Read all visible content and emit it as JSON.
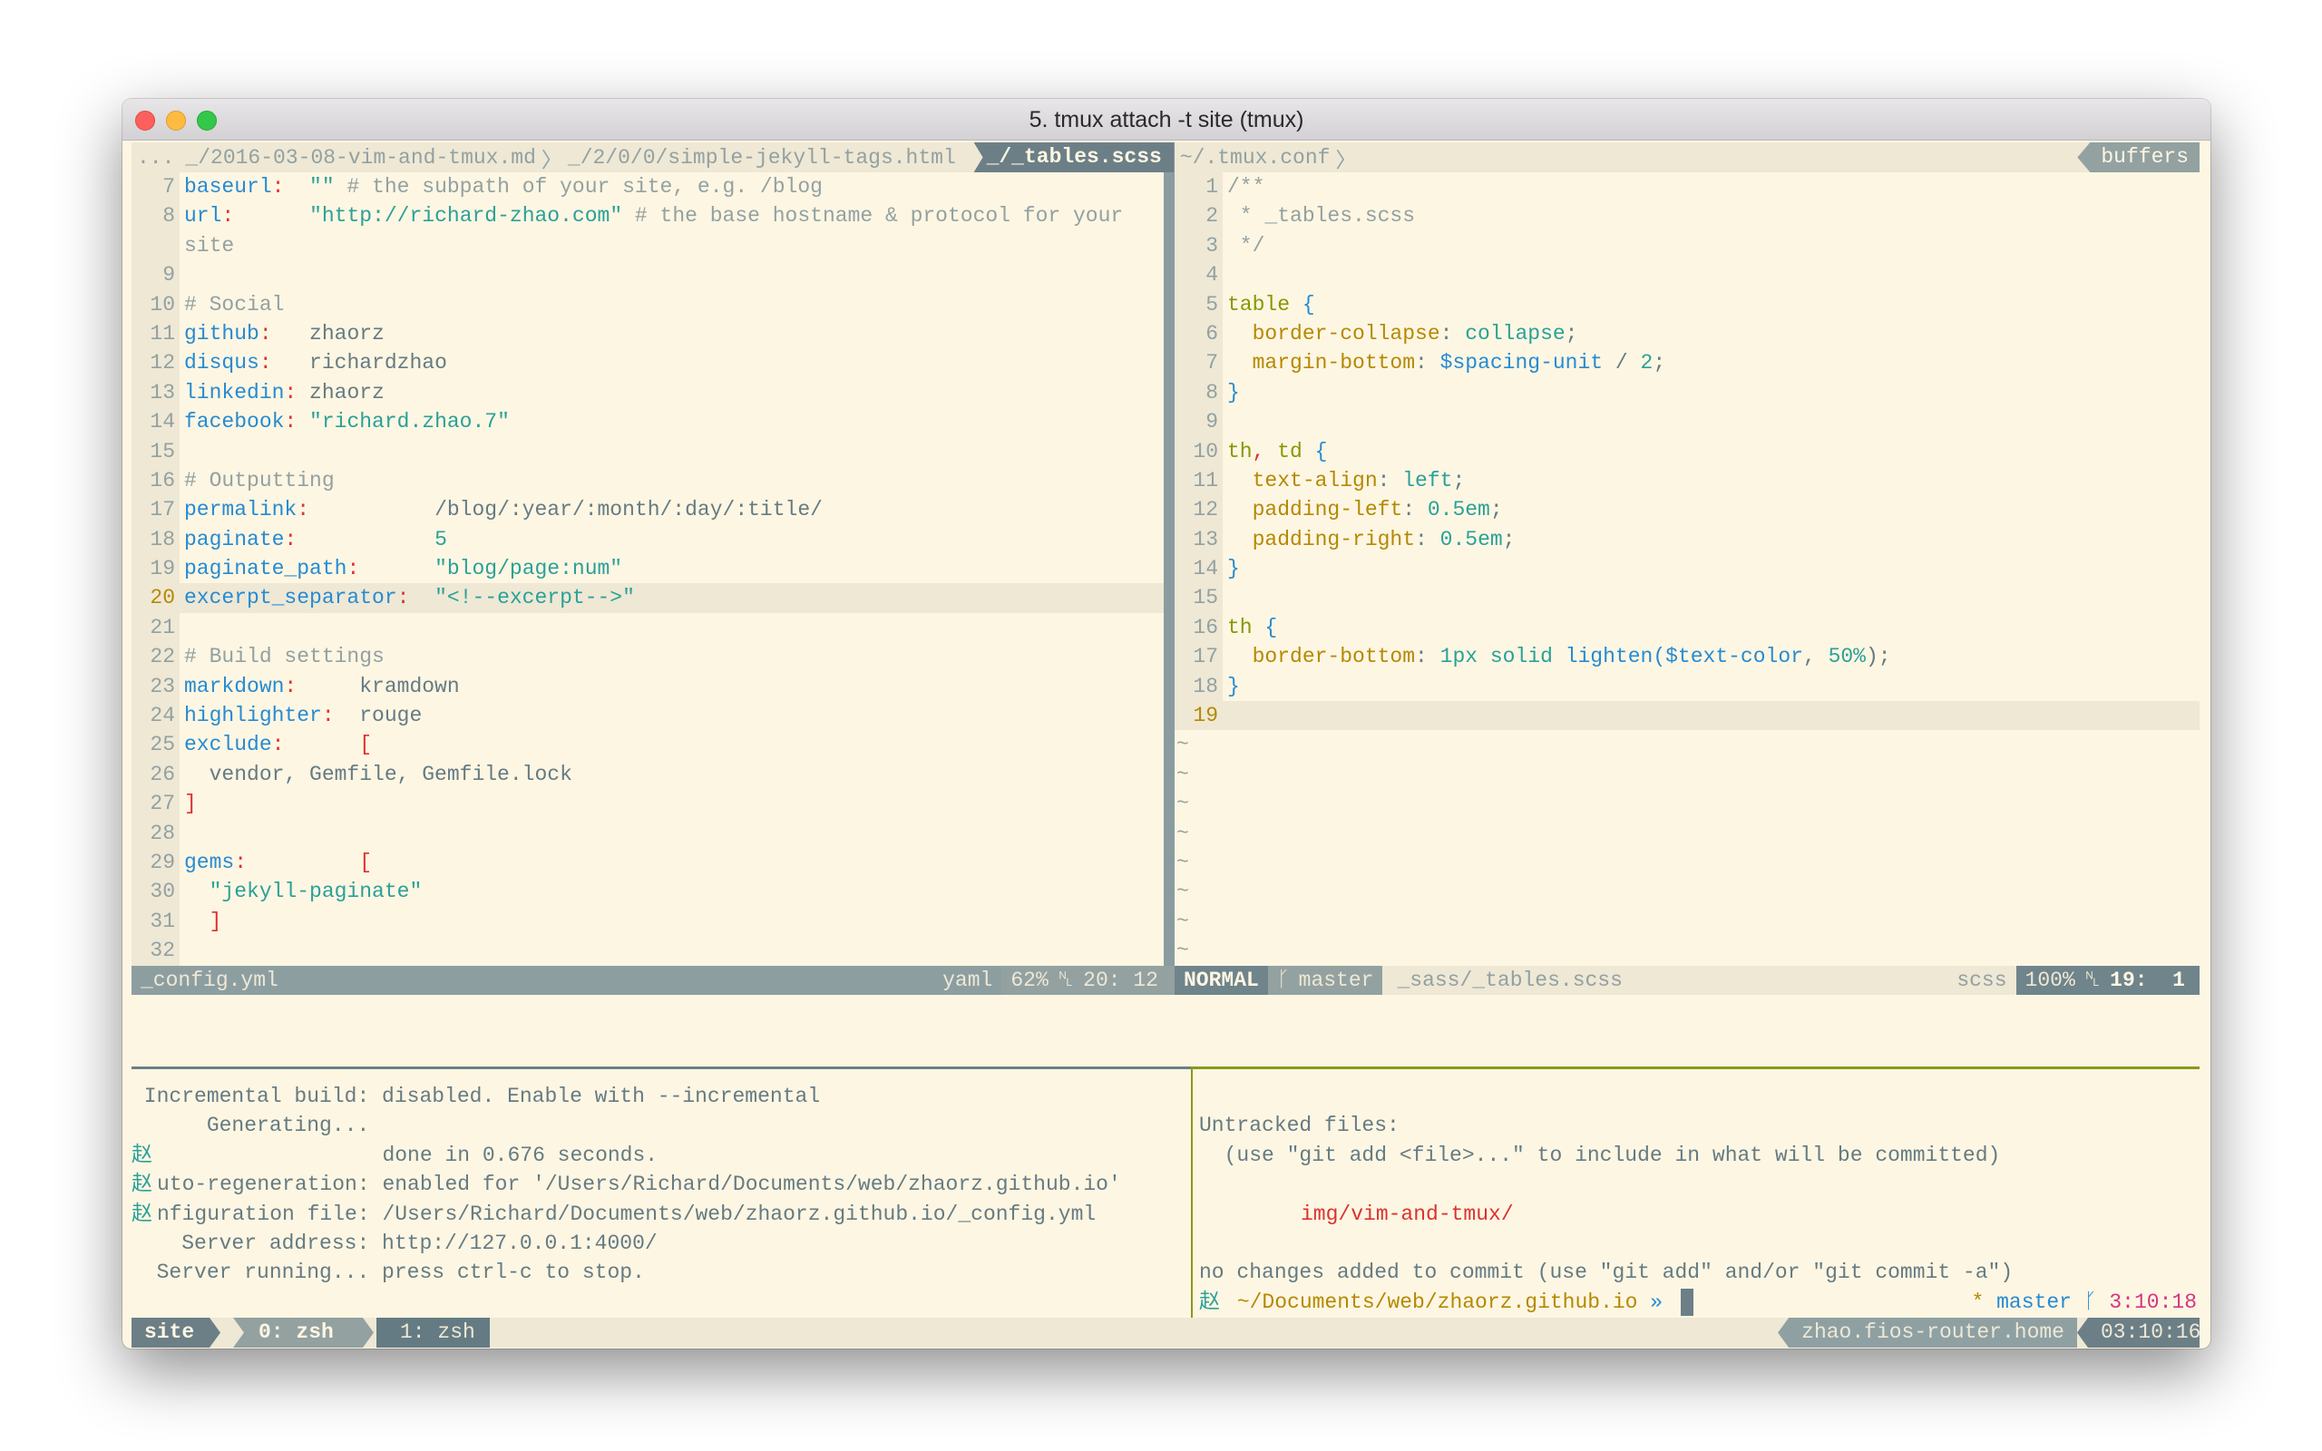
{
  "window": {
    "title": "5. tmux attach -t site (tmux)"
  },
  "tabline": {
    "ellipsis": "...",
    "tabs": [
      {
        "label": "_/2016-03-08-vim-and-tmux.md",
        "active": false
      },
      {
        "label": "_/2/0/0/simple-jekyll-tags.html",
        "active": false
      },
      {
        "label": "_/_tables.scss",
        "active": true
      },
      {
        "label": "~/.tmux.conf",
        "active": false
      }
    ],
    "buffers_label": "buffers"
  },
  "left_pane": {
    "lines": [
      {
        "n": "7",
        "tokens": [
          [
            "k",
            "baseurl"
          ],
          [
            "p",
            ":"
          ],
          [
            "t",
            "  "
          ],
          [
            "s",
            "\"\""
          ],
          [
            "c",
            " # the subpath of your site, e.g. /blog"
          ]
        ]
      },
      {
        "n": "8",
        "tokens": [
          [
            "k",
            "url"
          ],
          [
            "p",
            ":"
          ],
          [
            "t",
            "      "
          ],
          [
            "s",
            "\"http://richard-zhao.com\""
          ],
          [
            "c",
            " # the base hostname & protocol for your"
          ]
        ]
      },
      {
        "n": "",
        "tokens": [
          [
            "c",
            "site"
          ]
        ]
      },
      {
        "n": "9",
        "tokens": []
      },
      {
        "n": "10",
        "tokens": [
          [
            "c",
            "# Social"
          ]
        ]
      },
      {
        "n": "11",
        "tokens": [
          [
            "k",
            "github"
          ],
          [
            "p",
            ":"
          ],
          [
            "t",
            "   zhaorz"
          ]
        ]
      },
      {
        "n": "12",
        "tokens": [
          [
            "k",
            "disqus"
          ],
          [
            "p",
            ":"
          ],
          [
            "t",
            "   richardzhao"
          ]
        ]
      },
      {
        "n": "13",
        "tokens": [
          [
            "k",
            "linkedin"
          ],
          [
            "p",
            ":"
          ],
          [
            "t",
            " zhaorz"
          ]
        ]
      },
      {
        "n": "14",
        "tokens": [
          [
            "k",
            "facebook"
          ],
          [
            "p",
            ":"
          ],
          [
            "t",
            " "
          ],
          [
            "s",
            "\"richard.zhao.7\""
          ]
        ]
      },
      {
        "n": "15",
        "tokens": []
      },
      {
        "n": "16",
        "tokens": [
          [
            "c",
            "# Outputting"
          ]
        ]
      },
      {
        "n": "17",
        "tokens": [
          [
            "k",
            "permalink"
          ],
          [
            "p",
            ":"
          ],
          [
            "t",
            "          /blog/:year/:month/:day/:title/"
          ]
        ]
      },
      {
        "n": "18",
        "tokens": [
          [
            "k",
            "paginate"
          ],
          [
            "p",
            ":"
          ],
          [
            "t",
            "           "
          ],
          [
            "s",
            "5"
          ]
        ]
      },
      {
        "n": "19",
        "tokens": [
          [
            "k",
            "paginate_path"
          ],
          [
            "p",
            ":"
          ],
          [
            "t",
            "      "
          ],
          [
            "s",
            "\"blog/page:num\""
          ]
        ]
      },
      {
        "n": "20",
        "current": true,
        "tokens": [
          [
            "k",
            "excerpt_separator"
          ],
          [
            "p",
            ":"
          ],
          [
            "t",
            "  "
          ],
          [
            "s",
            "\"<!--excerpt-->\""
          ]
        ]
      },
      {
        "n": "21",
        "tokens": []
      },
      {
        "n": "22",
        "tokens": [
          [
            "c",
            "# Build settings"
          ]
        ]
      },
      {
        "n": "23",
        "tokens": [
          [
            "k",
            "markdown"
          ],
          [
            "p",
            ":"
          ],
          [
            "t",
            "     kramdown"
          ]
        ]
      },
      {
        "n": "24",
        "tokens": [
          [
            "k",
            "highlighter"
          ],
          [
            "p",
            ":"
          ],
          [
            "t",
            "  rouge"
          ]
        ]
      },
      {
        "n": "25",
        "tokens": [
          [
            "k",
            "exclude"
          ],
          [
            "p",
            ":"
          ],
          [
            "t",
            "      "
          ],
          [
            "p",
            "["
          ]
        ]
      },
      {
        "n": "26",
        "tokens": [
          [
            "t",
            "  vendor, Gemfile, Gemfile.lock"
          ]
        ]
      },
      {
        "n": "27",
        "tokens": [
          [
            "p",
            "]"
          ]
        ]
      },
      {
        "n": "28",
        "tokens": []
      },
      {
        "n": "29",
        "tokens": [
          [
            "k",
            "gems"
          ],
          [
            "p",
            ":"
          ],
          [
            "t",
            "         "
          ],
          [
            "p",
            "["
          ]
        ]
      },
      {
        "n": "30",
        "tokens": [
          [
            "s",
            "  \"jekyll-paginate\""
          ]
        ]
      },
      {
        "n": "31",
        "tokens": [
          [
            "p",
            "  ]"
          ]
        ]
      },
      {
        "n": "32",
        "tokens": []
      }
    ],
    "status": {
      "filename": "_config.yml",
      "filetype": "yaml",
      "percent": "62%",
      "position": "20: 12"
    }
  },
  "right_pane": {
    "lines": [
      {
        "n": "1",
        "tokens": [
          [
            "c",
            "/**"
          ]
        ]
      },
      {
        "n": "2",
        "tokens": [
          [
            "c",
            " * _tables.scss"
          ]
        ]
      },
      {
        "n": "3",
        "tokens": [
          [
            "c",
            " */"
          ]
        ]
      },
      {
        "n": "4",
        "tokens": []
      },
      {
        "n": "5",
        "tokens": [
          [
            "o",
            "table"
          ],
          [
            "t",
            " "
          ],
          [
            "k",
            "{"
          ]
        ]
      },
      {
        "n": "6",
        "tokens": [
          [
            "y",
            "  border-collapse"
          ],
          [
            "t",
            ": "
          ],
          [
            "s",
            "collapse"
          ],
          [
            "t",
            ";"
          ]
        ]
      },
      {
        "n": "7",
        "tokens": [
          [
            "y",
            "  margin-bottom"
          ],
          [
            "t",
            ": "
          ],
          [
            "k",
            "$spacing-unit"
          ],
          [
            "t",
            " / "
          ],
          [
            "s",
            "2"
          ],
          [
            "t",
            ";"
          ]
        ]
      },
      {
        "n": "8",
        "tokens": [
          [
            "k",
            "}"
          ]
        ]
      },
      {
        "n": "9",
        "tokens": []
      },
      {
        "n": "10",
        "tokens": [
          [
            "o",
            "th"
          ],
          [
            "p",
            ","
          ],
          [
            "o",
            " td"
          ],
          [
            "k",
            " {"
          ]
        ]
      },
      {
        "n": "11",
        "tokens": [
          [
            "y",
            "  text-align"
          ],
          [
            "t",
            ": "
          ],
          [
            "s",
            "left"
          ],
          [
            "t",
            ";"
          ]
        ]
      },
      {
        "n": "12",
        "tokens": [
          [
            "y",
            "  padding-left"
          ],
          [
            "t",
            ": "
          ],
          [
            "s",
            "0.5em"
          ],
          [
            "t",
            ";"
          ]
        ]
      },
      {
        "n": "13",
        "tokens": [
          [
            "y",
            "  padding-right"
          ],
          [
            "t",
            ": "
          ],
          [
            "s",
            "0.5em"
          ],
          [
            "t",
            ";"
          ]
        ]
      },
      {
        "n": "14",
        "tokens": [
          [
            "k",
            "}"
          ]
        ]
      },
      {
        "n": "15",
        "tokens": []
      },
      {
        "n": "16",
        "tokens": [
          [
            "o",
            "th"
          ],
          [
            "k",
            " {"
          ]
        ]
      },
      {
        "n": "17",
        "tokens": [
          [
            "y",
            "  border-bottom"
          ],
          [
            "t",
            ": "
          ],
          [
            "s",
            "1px solid"
          ],
          [
            "t",
            " "
          ],
          [
            "k",
            "lighten($text-color"
          ],
          [
            "t",
            ", "
          ],
          [
            "s",
            "50%"
          ],
          [
            "t",
            ");"
          ]
        ]
      },
      {
        "n": "18",
        "tokens": [
          [
            "k",
            "}"
          ]
        ]
      },
      {
        "n": "19",
        "current": true,
        "tokens": []
      }
    ],
    "tilde": "~",
    "tilde_rows": 8,
    "status": {
      "mode": "NORMAL",
      "branch": "master",
      "filepath": "_sass/_tables.scss",
      "filetype": "scss",
      "percent": "100%",
      "position": "19:  1"
    }
  },
  "terminal_left": {
    "lines": [
      {
        "prefix": "",
        "text": " Incremental build: disabled. Enable with --incremental"
      },
      {
        "prefix": "",
        "text": "      Generating..."
      },
      {
        "prefix": "赵",
        "text": "                  done in 0.676 seconds."
      },
      {
        "prefix": "赵",
        "text": "uto-regeneration: enabled for '/Users/Richard/Documents/web/zhaorz.github.io'"
      },
      {
        "prefix": "赵",
        "text": "nfiguration file: /Users/Richard/Documents/web/zhaorz.github.io/_config.yml"
      },
      {
        "prefix": "",
        "text": "    Server address: http://127.0.0.1:4000/"
      },
      {
        "prefix": "",
        "text": "  Server running... press ctrl-c to stop."
      }
    ]
  },
  "terminal_right": {
    "lines": [
      "",
      "Untracked files:",
      "  (use \"git add <file>...\" to include in what will be committed)",
      "",
      "",
      "",
      "no changes added to commit (use \"git add\" and/or \"git commit -a\")"
    ],
    "untracked_file": "img/vim-and-tmux/",
    "prompt": {
      "glyph": "赵",
      "path": "~/Documents/web/zhaorz.github.io",
      "arrow": "»",
      "star": "*",
      "branch": "master",
      "time": "3:10:18"
    }
  },
  "tmux": {
    "session": "site",
    "windows": [
      {
        "label": "0: zsh",
        "active": true
      },
      {
        "label": "1: zsh",
        "active": false
      }
    ],
    "hostname": "zhao.fios-router.home",
    "clock": "03:10:16"
  },
  "colors": {
    "background": "#fdf6e3",
    "key": "#268bd2",
    "string": "#2aa198",
    "punct": "#dc322f",
    "comment": "#93a1a1",
    "property": "#b58900",
    "selector": "#859900",
    "status_dark": "#6c7f87"
  }
}
